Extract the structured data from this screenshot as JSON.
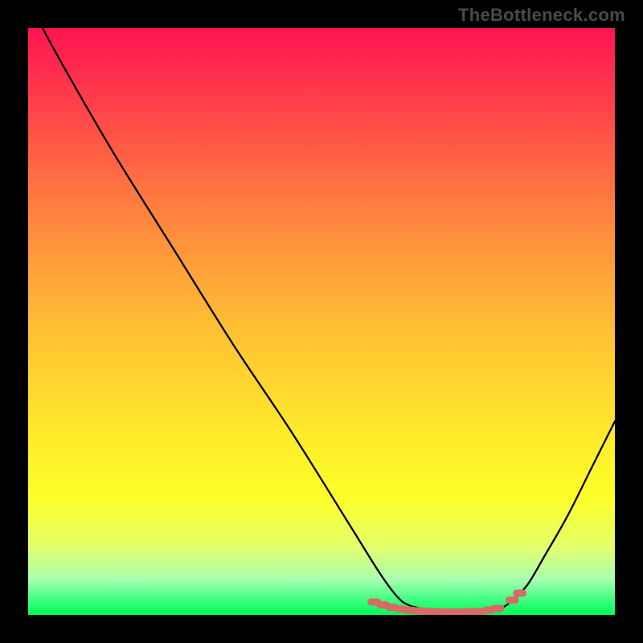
{
  "watermark": {
    "text": "TheBottleneck.com"
  },
  "chart_data": {
    "type": "line",
    "title": "",
    "xlabel": "",
    "ylabel": "",
    "xlim": [
      0,
      100
    ],
    "ylim": [
      0,
      100
    ],
    "grid": false,
    "legend": false,
    "series": [
      {
        "name": "bottleneck-curve",
        "x": [
          0,
          3,
          8,
          15,
          25,
          35,
          45,
          55,
          60,
          63,
          65,
          68,
          71,
          74,
          77,
          80,
          82,
          85,
          88,
          92,
          96,
          100
        ],
        "values": [
          105,
          99,
          90,
          78,
          62,
          46,
          31,
          15,
          7,
          3,
          1.6,
          0.9,
          0.6,
          0.5,
          0.6,
          1.0,
          2.0,
          5.0,
          10,
          17,
          25,
          33
        ],
        "color": "#000000"
      },
      {
        "name": "low-bottleneck-markers",
        "type": "scatter",
        "x": [
          59,
          60.5,
          62,
          63.5,
          65,
          66.5,
          68,
          69.5,
          71,
          72.5,
          74,
          75.5,
          77,
          78.5,
          80,
          82.5,
          83.8
        ],
        "values": [
          2.2,
          1.7,
          1.3,
          1.0,
          0.8,
          0.7,
          0.6,
          0.55,
          0.5,
          0.5,
          0.5,
          0.55,
          0.6,
          0.8,
          1.1,
          2.5,
          3.7
        ],
        "color": "#d86b63"
      }
    ],
    "gradient_colors_top_to_bottom": [
      "#ff1450",
      "#ff8e3d",
      "#ffe82b",
      "#2eff7a"
    ]
  }
}
